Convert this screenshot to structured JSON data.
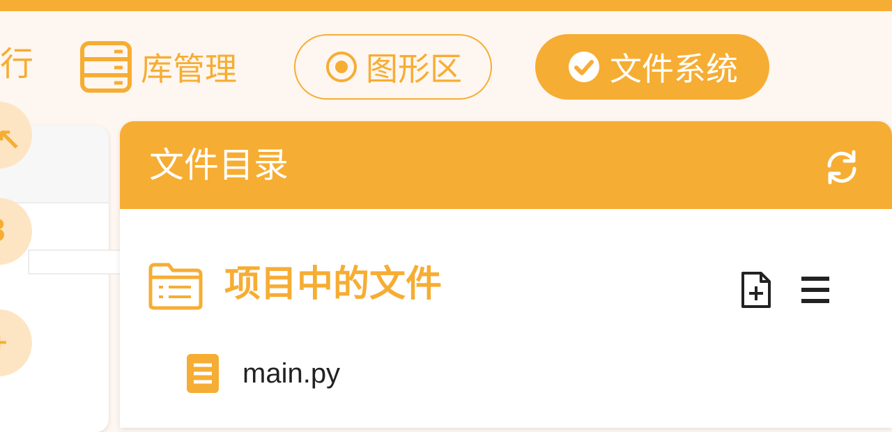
{
  "colors": {
    "accent": "#f6ad33",
    "accent_light": "#fde5c3",
    "background": "#fef6f0",
    "panel": "#ffffff",
    "text_dark": "#222222"
  },
  "nav": {
    "partial_label": "行",
    "library": {
      "label": "库管理",
      "icon": "server-icon"
    },
    "graphics": {
      "label": "图形区",
      "icon": "radio-dot-icon"
    },
    "files": {
      "label": "文件系统",
      "icon": "check-circle-icon",
      "active": true
    }
  },
  "file_panel": {
    "title": "文件目录",
    "refresh_icon": "refresh-icon",
    "section": {
      "title": "项目中的文件",
      "icon": "folder-list-icon",
      "actions": [
        "add-file-icon",
        "menu-icon"
      ]
    },
    "files": [
      {
        "name": "main.py",
        "icon": "file-text-icon"
      }
    ]
  }
}
